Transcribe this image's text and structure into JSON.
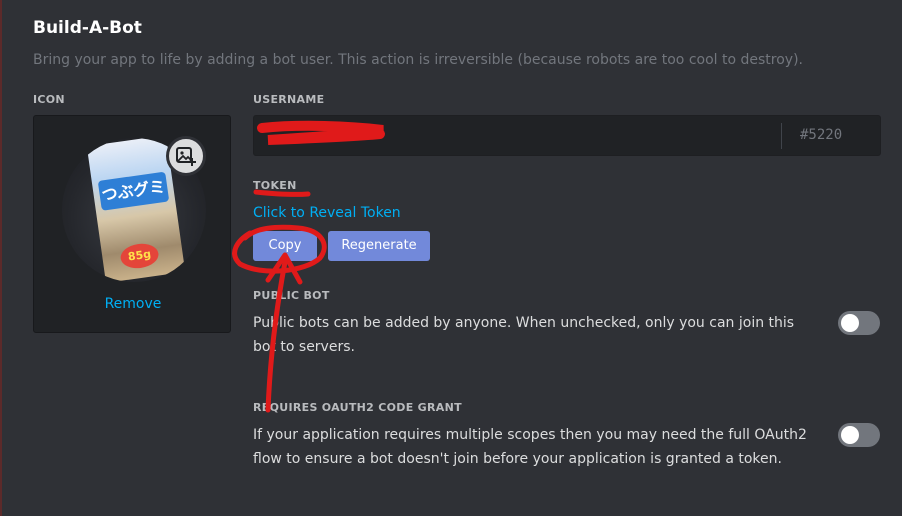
{
  "header": {
    "title": "Build-A-Bot",
    "subtitle": "Bring your app to life by adding a bot user. This action is irreversible (because robots are too cool to destroy)."
  },
  "icon_section": {
    "label": "ICON",
    "candy_text": "つぶグミ",
    "candy_price": "85g",
    "remove_label": "Remove"
  },
  "username": {
    "label": "USERNAME",
    "value": "",
    "discriminator": "#5220"
  },
  "token": {
    "label": "TOKEN",
    "reveal_label": "Click to Reveal Token",
    "copy_label": "Copy",
    "regenerate_label": "Regenerate"
  },
  "public_bot": {
    "label": "PUBLIC BOT",
    "description": "Public bots can be added by anyone. When unchecked, only you can join this bot to servers.",
    "enabled": false
  },
  "oauth2": {
    "label": "REQUIRES OAUTH2 CODE GRANT",
    "description": "If your application requires multiple scopes then you may need the full OAuth2 flow to ensure a bot doesn't join before your application is granted a token.",
    "enabled": false
  },
  "colors": {
    "background": "#2f3136",
    "accent": "#7289da",
    "link": "#00aff4",
    "annotation": "#e01a1a"
  }
}
